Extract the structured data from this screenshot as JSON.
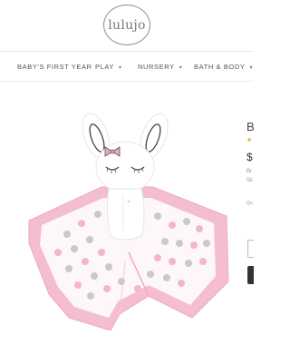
{
  "header": {
    "logo_text": "lulujo"
  },
  "nav": {
    "items": [
      {
        "label": "BABY'S FIRST YEAR",
        "has_dropdown": false
      },
      {
        "label": "PLAY",
        "has_dropdown": true
      },
      {
        "label": "NURSERY",
        "has_dropdown": true
      },
      {
        "label": "BATH & BODY",
        "has_dropdown": true
      }
    ],
    "dropdown_glyph": "▾"
  },
  "product": {
    "image_icon": "bunny-lovey-icon",
    "colors": {
      "pink": "#f7c6d6",
      "pink_border": "#f3b6ca",
      "dot_pink": "#f4b9cc",
      "dot_gray": "#c8c8c8"
    }
  },
  "details": {
    "title_initial": "B",
    "stars": "★",
    "price_prefix": "$",
    "line1": "Br",
    "line2": "Sk",
    "qty_label": "Qu",
    "star_color": "#e9b12f"
  }
}
